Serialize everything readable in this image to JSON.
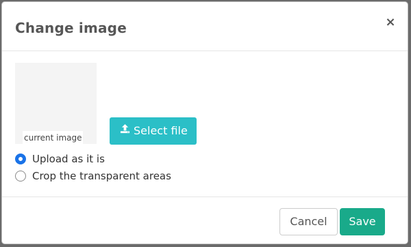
{
  "dialog": {
    "title": "Change image",
    "close_symbol": "×"
  },
  "preview": {
    "caption": "current image"
  },
  "select_file": {
    "label": "Select file",
    "icon": "upload-icon",
    "color": "#2bbfc7"
  },
  "options": [
    {
      "label": "Upload as it is",
      "checked": true
    },
    {
      "label": "Crop the transparent areas",
      "checked": false
    }
  ],
  "footer": {
    "cancel_label": "Cancel",
    "save_label": "Save",
    "save_color": "#19aa8a"
  },
  "colors": {
    "radio_accent": "#1a73e8"
  }
}
